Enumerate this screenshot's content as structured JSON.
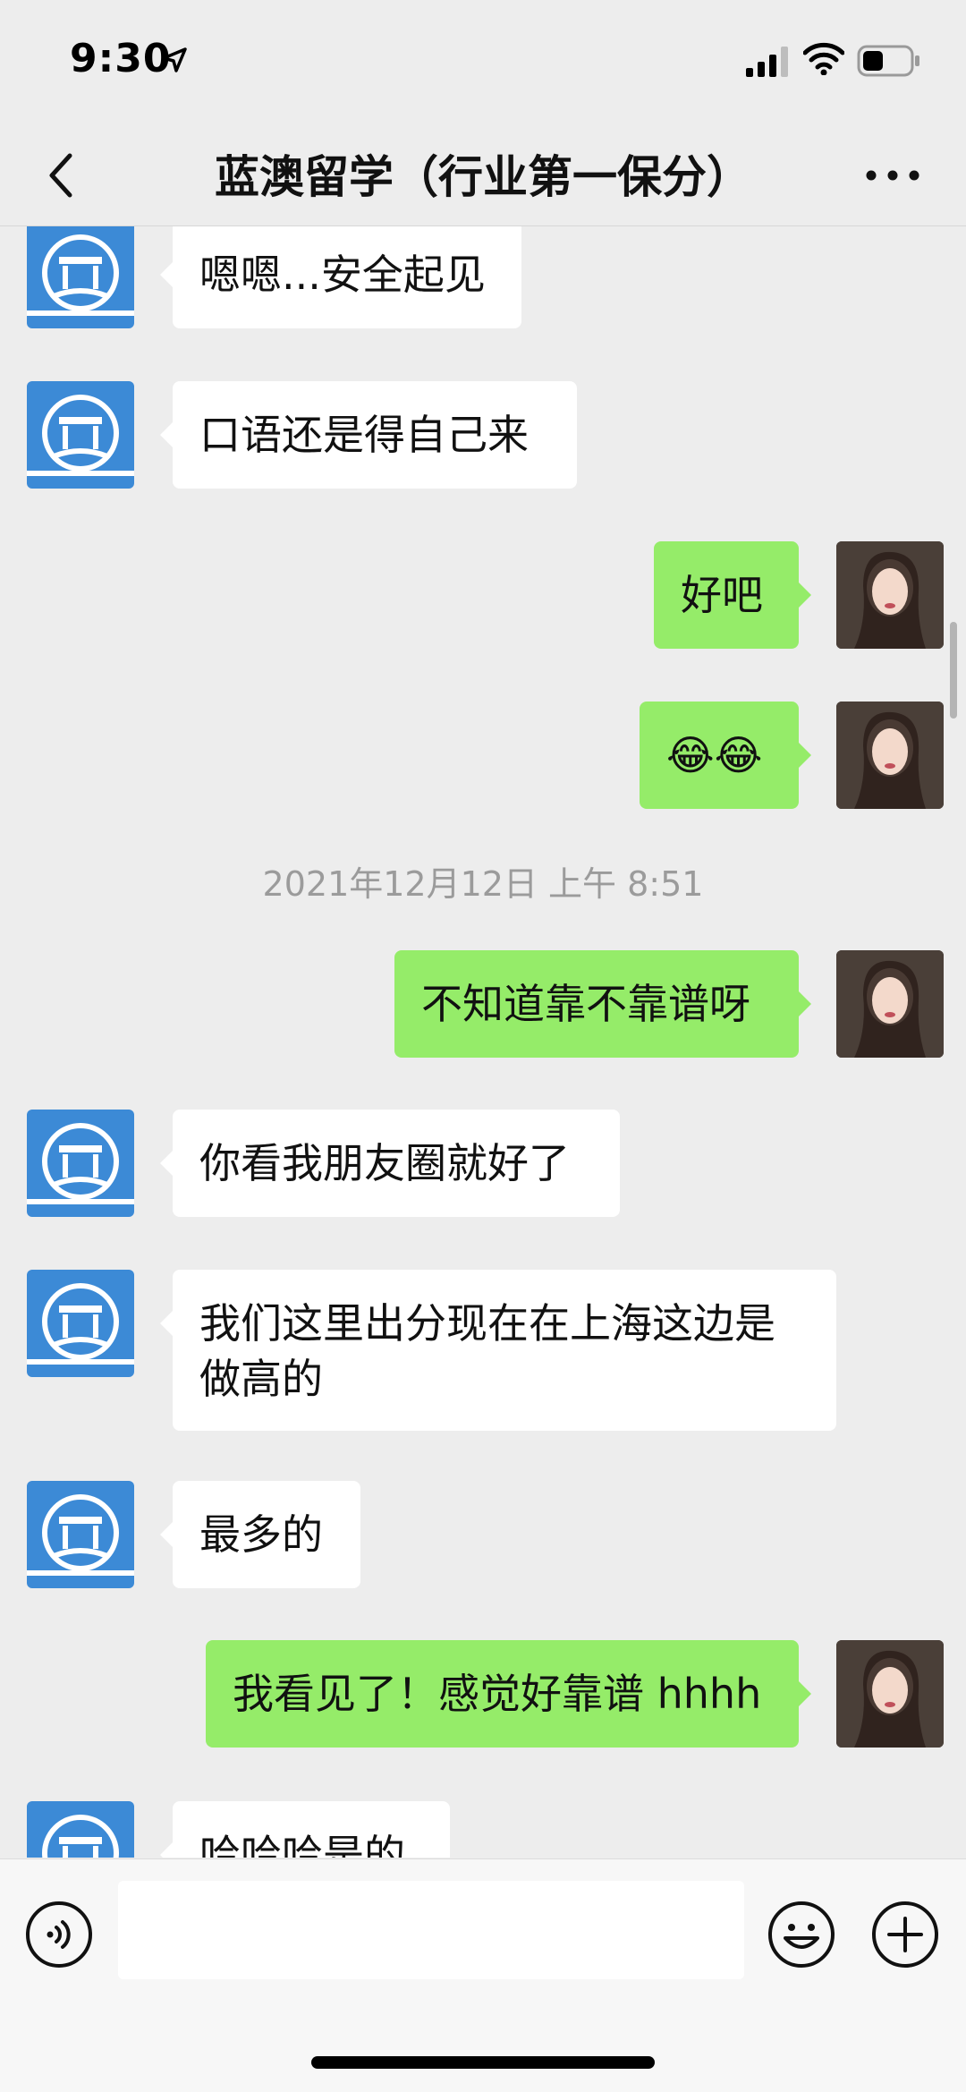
{
  "status_bar": {
    "time": "9:30"
  },
  "nav": {
    "title": "蓝澳留学（行业第一保分）"
  },
  "messages": [
    {
      "side": "left",
      "text": "嗯嗯...安全起见"
    },
    {
      "side": "left",
      "text": "口语还是得自己来"
    },
    {
      "side": "right",
      "text": "好吧"
    },
    {
      "side": "right",
      "text": "😂😂"
    },
    {
      "timestamp": "2021年12月12日 上午 8:51"
    },
    {
      "side": "right",
      "text": "不知道靠不靠谱呀"
    },
    {
      "side": "left",
      "text": "你看我朋友圈就好了"
    },
    {
      "side": "left",
      "line1": "我们这里出分现在在上海这边是",
      "line2": "做高的"
    },
    {
      "side": "left",
      "text": "最多的"
    },
    {
      "side": "right",
      "text": "我看见了！感觉好靠谱 hhhh"
    },
    {
      "side": "left",
      "text": "哈哈哈是的"
    }
  ],
  "colors": {
    "sent_bubble": "#95ec69",
    "received_bubble": "#ffffff",
    "background": "#ededed",
    "avatar_brand": "#3c8ad6"
  },
  "icons": [
    "location-arrow-icon",
    "signal-icon",
    "wifi-icon",
    "battery-icon",
    "back-chevron-icon",
    "more-dots-icon",
    "voice-icon",
    "emoji-icon",
    "plus-icon"
  ]
}
